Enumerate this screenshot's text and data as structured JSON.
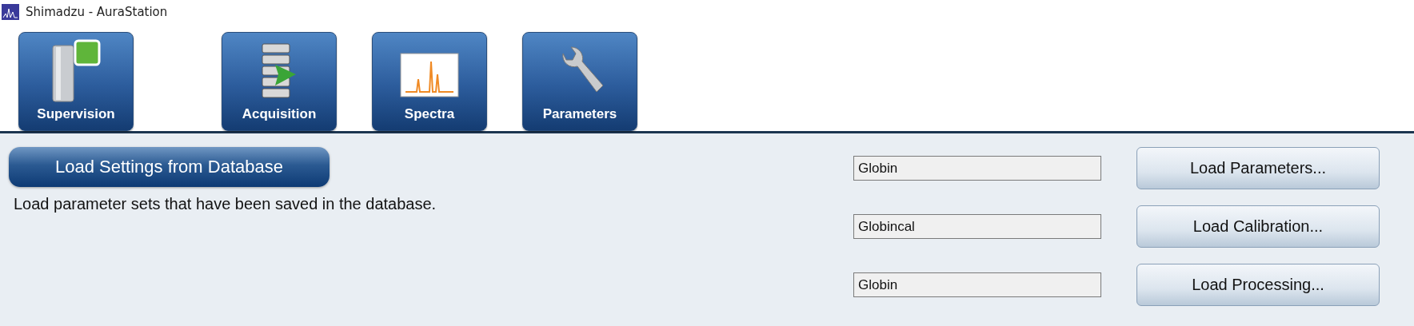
{
  "window": {
    "title": "Shimadzu - AuraStation"
  },
  "modules": [
    {
      "kind": "supervision",
      "label": "Supervision"
    },
    {
      "kind": "acquisition",
      "label": "Acquisition"
    },
    {
      "kind": "spectra",
      "label": "Spectra"
    },
    {
      "kind": "parameters",
      "label": "Parameters"
    }
  ],
  "section": {
    "title": "Load Settings from Database",
    "description": "Load parameter sets that have been saved in the database."
  },
  "loaders": [
    {
      "value": "Globin",
      "button": "Load Parameters..."
    },
    {
      "value": "Globincal",
      "button": "Load Calibration..."
    },
    {
      "value": "Globin",
      "button": "Load Processing..."
    }
  ]
}
